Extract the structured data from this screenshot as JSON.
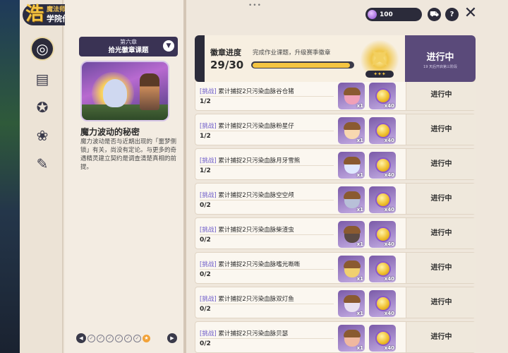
{
  "app": {
    "title_line1": "魔法师手册",
    "title_line2": "学院作业",
    "logo_glyph": "浩"
  },
  "nav": {
    "items": [
      {
        "name": "compass",
        "icon": "compass-icon",
        "active": true
      },
      {
        "name": "scroll",
        "icon": "scroll-icon",
        "active": false
      },
      {
        "name": "badge",
        "icon": "badge-icon",
        "active": false
      },
      {
        "name": "paw",
        "icon": "paw-icon",
        "active": false
      },
      {
        "name": "tag",
        "icon": "tag-icon",
        "active": false
      }
    ]
  },
  "chapter": {
    "label": "第六章",
    "name": "拾光徽章课题"
  },
  "quest": {
    "title": "魔力波动的秘密",
    "description": "魔力波动是否与近期出现的「噩梦侧锁」有关，尚没有定论。与更多的奇遇精灵建立契约是调查清楚真相的前提。"
  },
  "hud": {
    "currency": "100",
    "shop_icon": "cart-icon",
    "help_label": "?",
    "close_label": "✕"
  },
  "progress": {
    "title": "徽章进度",
    "subtitle": "完成作业课题，升级赛季徽章",
    "count": "29/30",
    "value": 29,
    "max": 30,
    "status": "进行中",
    "status_sub": "19 天后开启第三阶段",
    "medal_stars": "✦✦✦"
  },
  "tasks": [
    {
      "tag": "[挑战]",
      "text": "累计捕捉2只污染血脉谷仓猪",
      "progress": "1/2",
      "reward1_qty": "x1",
      "reward2_qty": "x40",
      "status": "进行中",
      "acorn_color": "#f0a0b8"
    },
    {
      "tag": "[挑战]",
      "text": "累计捕捉2只污染血脉粉星仔",
      "progress": "1/2",
      "reward1_qty": "x1",
      "reward2_qty": "x40",
      "status": "进行中",
      "acorn_color": "#f8d8b0"
    },
    {
      "tag": "[挑战]",
      "text": "累计捕捉2只污染血脉月牙雪熊",
      "progress": "1/2",
      "reward1_qty": "x1",
      "reward2_qty": "x40",
      "status": "进行中",
      "acorn_color": "#dfe8ff"
    },
    {
      "tag": "[挑战]",
      "text": "累计捕捉2只污染血脉空空颅",
      "progress": "0/2",
      "reward1_qty": "x1",
      "reward2_qty": "x40",
      "status": "进行中",
      "acorn_color": "#b8c0d8"
    },
    {
      "tag": "[挑战]",
      "text": "累计捕捉2只污染血脉柴渣虫",
      "progress": "0/2",
      "reward1_qty": "x1",
      "reward2_qty": "x40",
      "status": "进行中",
      "acorn_color": "#5a4a44"
    },
    {
      "tag": "[挑战]",
      "text": "累计捕捉2只污染血脉嗜光嘶嘶",
      "progress": "0/2",
      "reward1_qty": "x1",
      "reward2_qty": "x40",
      "status": "进行中",
      "acorn_color": "#f0d070"
    },
    {
      "tag": "[挑战]",
      "text": "累计捕捉2只污染血脉双灯鱼",
      "progress": "0/2",
      "reward1_qty": "x1",
      "reward2_qty": "x40",
      "status": "进行中",
      "acorn_color": "#e8e0f0"
    },
    {
      "tag": "[挑战]",
      "text": "累计捕捉2只污染血脉贝瑟",
      "progress": "0/2",
      "reward1_qty": "x1",
      "reward2_qty": "x40",
      "status": "进行中",
      "acorn_color": "#f0b8a0"
    }
  ],
  "pager": {
    "prev": "◀",
    "next": "▶",
    "dots": [
      "✓",
      "✓",
      "✓",
      "✓",
      "✓",
      "✓",
      "★"
    ]
  },
  "colors": {
    "accent_purple": "#5a4a7a",
    "tag_purple": "#6a58c8",
    "gold": "#f5c542",
    "dark": "#2b2b3a"
  }
}
